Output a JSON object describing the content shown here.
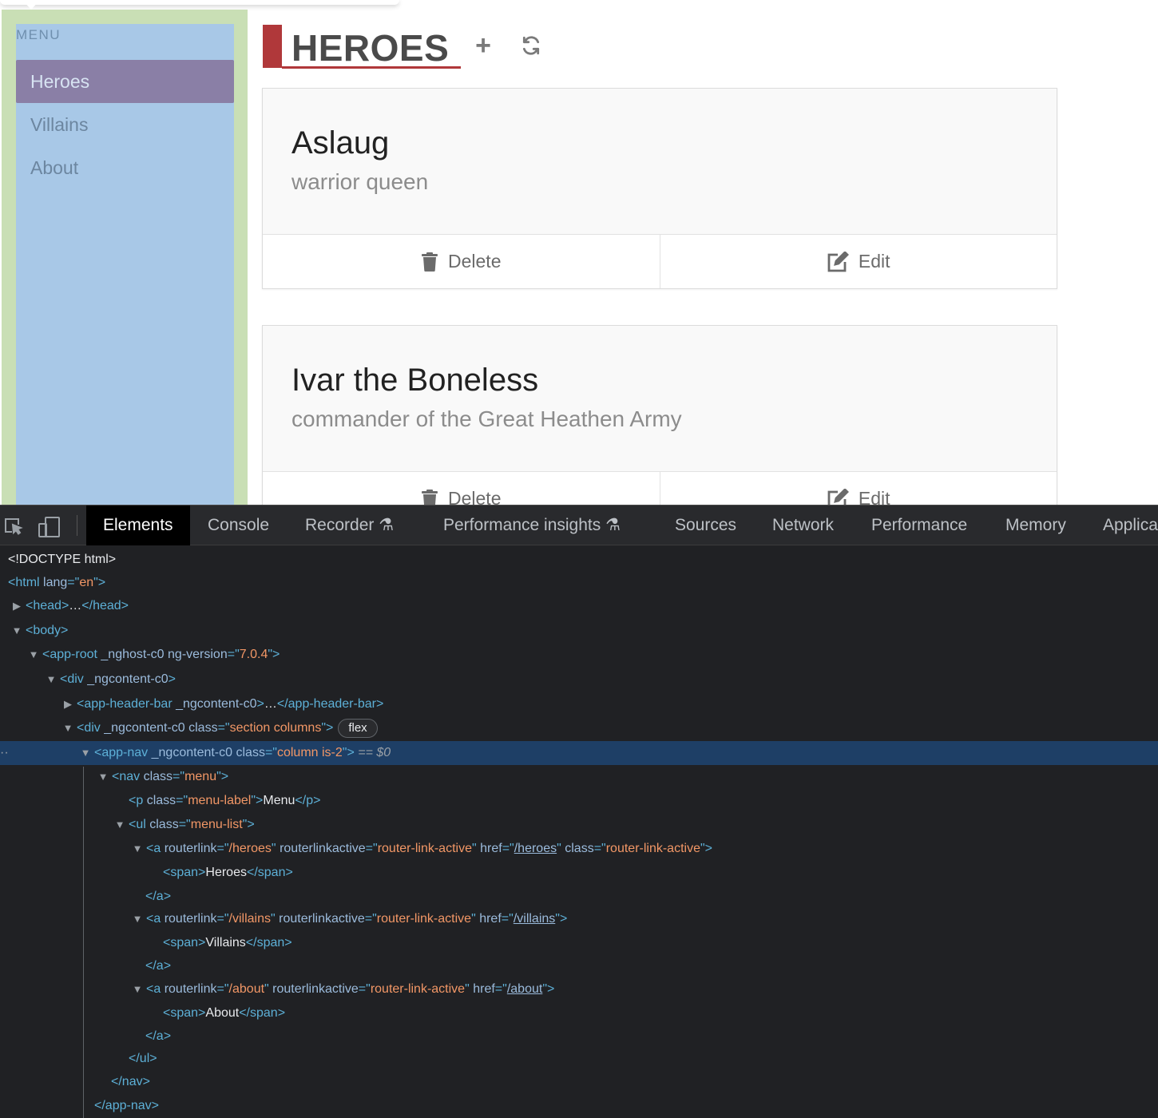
{
  "menu": {
    "label": "MENU",
    "items": [
      {
        "label": "Heroes",
        "active": true
      },
      {
        "label": "Villains",
        "active": false
      },
      {
        "label": "About",
        "active": false
      }
    ]
  },
  "page": {
    "title": "HEROES",
    "add_icon": "plus-icon",
    "refresh_icon": "refresh-icon"
  },
  "heroes": [
    {
      "name": "Aslaug",
      "description": "warrior queen"
    },
    {
      "name": "Ivar the Boneless",
      "description": "commander of the Great Heathen Army"
    }
  ],
  "card_actions": {
    "delete": "Delete",
    "edit": "Edit"
  },
  "devtools": {
    "tabs": [
      "Elements",
      "Console",
      "Recorder",
      "Performance insights",
      "Sources",
      "Network",
      "Performance",
      "Memory",
      "Applica"
    ],
    "active_tab": "Elements",
    "code": {
      "doctype": "<!DOCTYPE html>",
      "html_tag": "html",
      "html_lang_attr": "lang",
      "html_lang_val": "en",
      "head_tag": "head",
      "body_tag": "body",
      "app_root_tag": "app-root",
      "app_root_attr1": "_nghost-c0",
      "app_root_attr2": "ng-version",
      "app_root_ver": "7.0.4",
      "div_tag": "div",
      "ngcontent": "_ngcontent-c0",
      "header_bar_tag": "app-header-bar",
      "class_attr": "class",
      "section_class": "section columns",
      "flex_badge": "flex",
      "app_nav_tag": "app-nav",
      "app_nav_class": "column is-2",
      "selected_marker": "== $0",
      "nav_tag": "nav",
      "nav_class": "menu",
      "p_tag": "p",
      "p_class": "menu-label",
      "p_text": "Menu",
      "ul_tag": "ul",
      "ul_class": "menu-list",
      "a_tag": "a",
      "routerlink_attr": "routerlink",
      "routerlinkactive_attr": "routerlinkactive",
      "href_attr": "href",
      "rla_val": "router-link-active",
      "heroes_path": "/heroes",
      "villains_path": "/villains",
      "about_path": "/about",
      "span_tag": "span",
      "heroes_text": "Heroes",
      "villains_text": "Villains",
      "about_text": "About"
    }
  }
}
